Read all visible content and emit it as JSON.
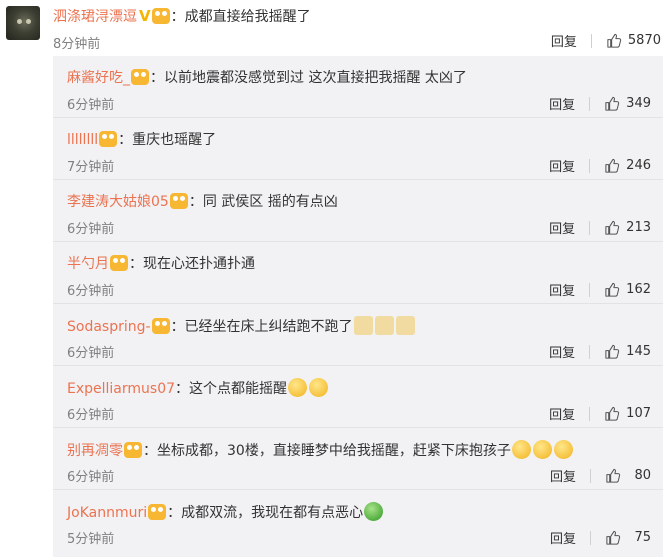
{
  "top_comment": {
    "username": "泗涤珺浔漂逗",
    "text": "：成都直接给我摇醒了",
    "time": "8分钟前",
    "reply_label": "回复",
    "likes": "5870"
  },
  "replies": [
    {
      "username": "麻酱好吃_",
      "text": "：以前地震都没感觉到过 这次直接把我摇醒 太凶了",
      "time": "6分钟前",
      "reply_label": "回复",
      "likes": "349"
    },
    {
      "username": "llllllll",
      "text": "：重庆也瑶醒了",
      "time": "7分钟前",
      "reply_label": "回复",
      "likes": "246"
    },
    {
      "username": "李建涛大姑娘05",
      "text": "：同 武侯区 摇的有点凶",
      "time": "6分钟前",
      "reply_label": "回复",
      "likes": "213"
    },
    {
      "username": "半勺月",
      "text": "：现在心还扑通扑通",
      "time": "6分钟前",
      "reply_label": "回复",
      "likes": "162"
    },
    {
      "username": "Sodaspring-",
      "text": "：已经坐在床上纠结跑不跑了",
      "time": "6分钟前",
      "reply_label": "回复",
      "likes": "145"
    },
    {
      "username": "Expelliarmus07",
      "text": "：这个点都能摇醒",
      "time": "6分钟前",
      "reply_label": "回复",
      "likes": "107"
    },
    {
      "username": "别再凋零",
      "text": "：坐标成都，30楼，直接睡梦中给我摇醒，赶紧下床抱孩子",
      "time": "6分钟前",
      "reply_label": "回复",
      "likes": "80"
    },
    {
      "username": "JoKannmuri",
      "text": "：成都双流，我现在都有点恶心",
      "time": "5分钟前",
      "reply_label": "回复",
      "likes": "75"
    }
  ],
  "icons": {
    "like": "thumbs-up-icon",
    "member": "member-badge-icon",
    "verified": "v-badge-icon"
  },
  "colors": {
    "username": "#eb7350",
    "reply_bg": "#f2f2f5"
  }
}
